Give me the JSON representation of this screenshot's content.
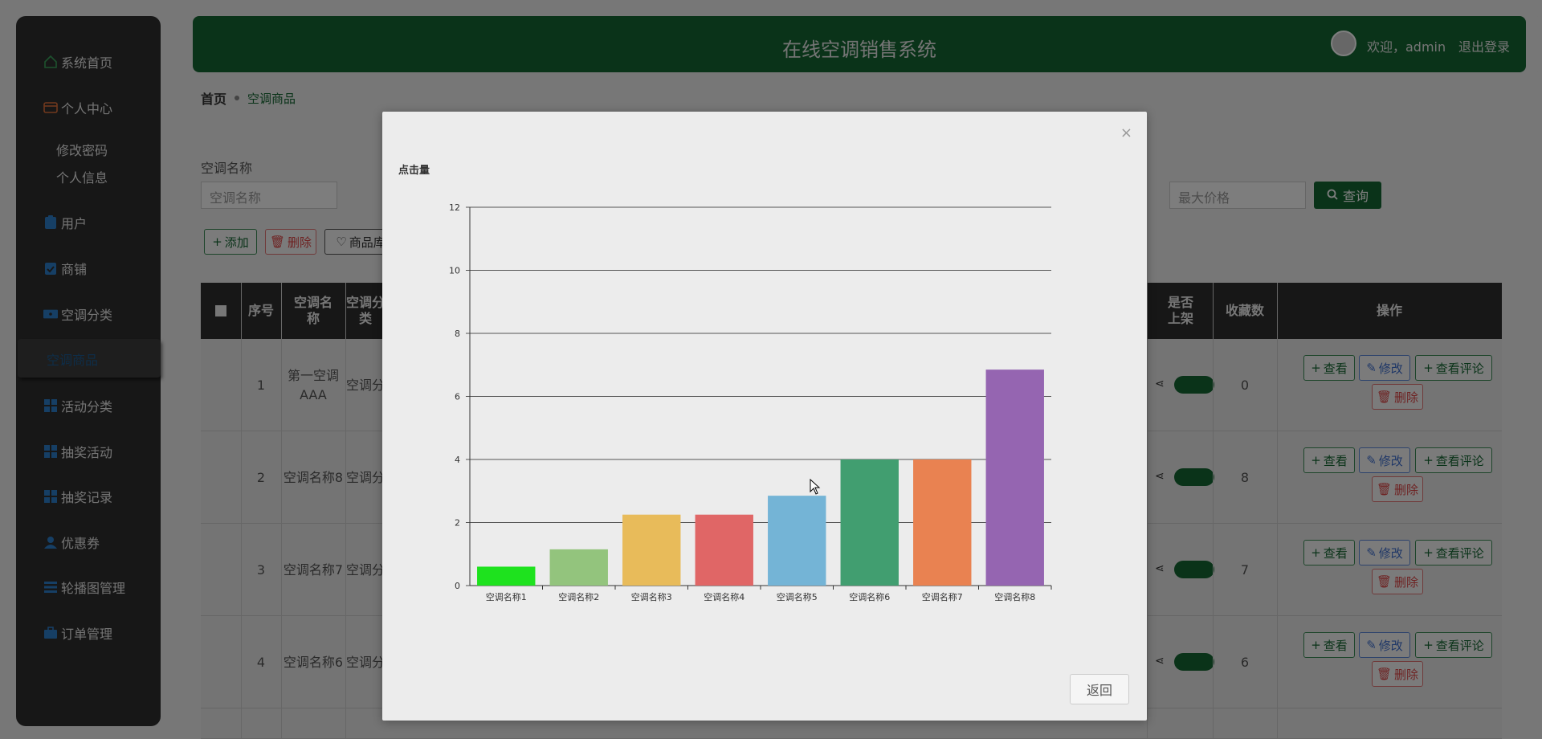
{
  "header": {
    "title": "在线空调销售系统",
    "welcome": "欢迎，admin",
    "logout": "退出登录"
  },
  "sidebar": {
    "home": "系统首页",
    "personal": "个人中心",
    "sub_password": "修改密码",
    "sub_info": "个人信息",
    "users": "用户",
    "shops": "商铺",
    "ac_category": "空调分类",
    "ac_goods": "空调商品",
    "activity_category": "活动分类",
    "lottery": "抽奖活动",
    "lottery_records": "抽奖记录",
    "coupons": "优惠券",
    "banner": "轮播图管理",
    "orders": "订单管理"
  },
  "breadcrumb": {
    "home": "首页",
    "current": "空调商品"
  },
  "search": {
    "label": "空调名称",
    "name_placeholder": "空调名称",
    "max_price_placeholder": "最大价格",
    "button": "查询"
  },
  "toolbar": {
    "add": "添加",
    "delete": "删除",
    "favorites": "商品库"
  },
  "table": {
    "headers": {
      "index": "序号",
      "name": "空调名称",
      "category": "空调分类",
      "on_shelf": "是否上架",
      "favorites": "收藏数",
      "actions": "操作"
    },
    "rows": [
      {
        "index": "1",
        "name": "第一空调AAA",
        "category": "空调分",
        "favorites": "0"
      },
      {
        "index": "2",
        "name": "空调名称8",
        "category": "空调分",
        "favorites": "8"
      },
      {
        "index": "3",
        "name": "空调名称7",
        "category": "空调分",
        "favorites": "7"
      },
      {
        "index": "4",
        "name": "空调名称6",
        "category": "空调分",
        "favorites": "6"
      }
    ],
    "actions": {
      "view": "查看",
      "edit": "修改",
      "view_comments": "查看评论",
      "delete": "删除"
    }
  },
  "modal": {
    "return_button": "返回",
    "close": "×"
  },
  "chart_data": {
    "type": "bar",
    "title": "点击量",
    "categories": [
      "空调名称1",
      "空调名称2",
      "空调名称3",
      "空调名称4",
      "空调名称5",
      "空调名称6",
      "空调名称7",
      "空调名称8"
    ],
    "values": [
      0.6,
      1.15,
      2.25,
      2.25,
      2.85,
      4.0,
      4.0,
      6.85
    ],
    "colors": [
      "#1ee21e",
      "#93c47d",
      "#e8bb5a",
      "#e06666",
      "#74b4d6",
      "#419e70",
      "#e98251",
      "#9565b1"
    ],
    "ylim": [
      0,
      12
    ],
    "yticks": [
      0,
      2,
      4,
      6,
      8,
      10,
      12
    ],
    "grid": true
  }
}
